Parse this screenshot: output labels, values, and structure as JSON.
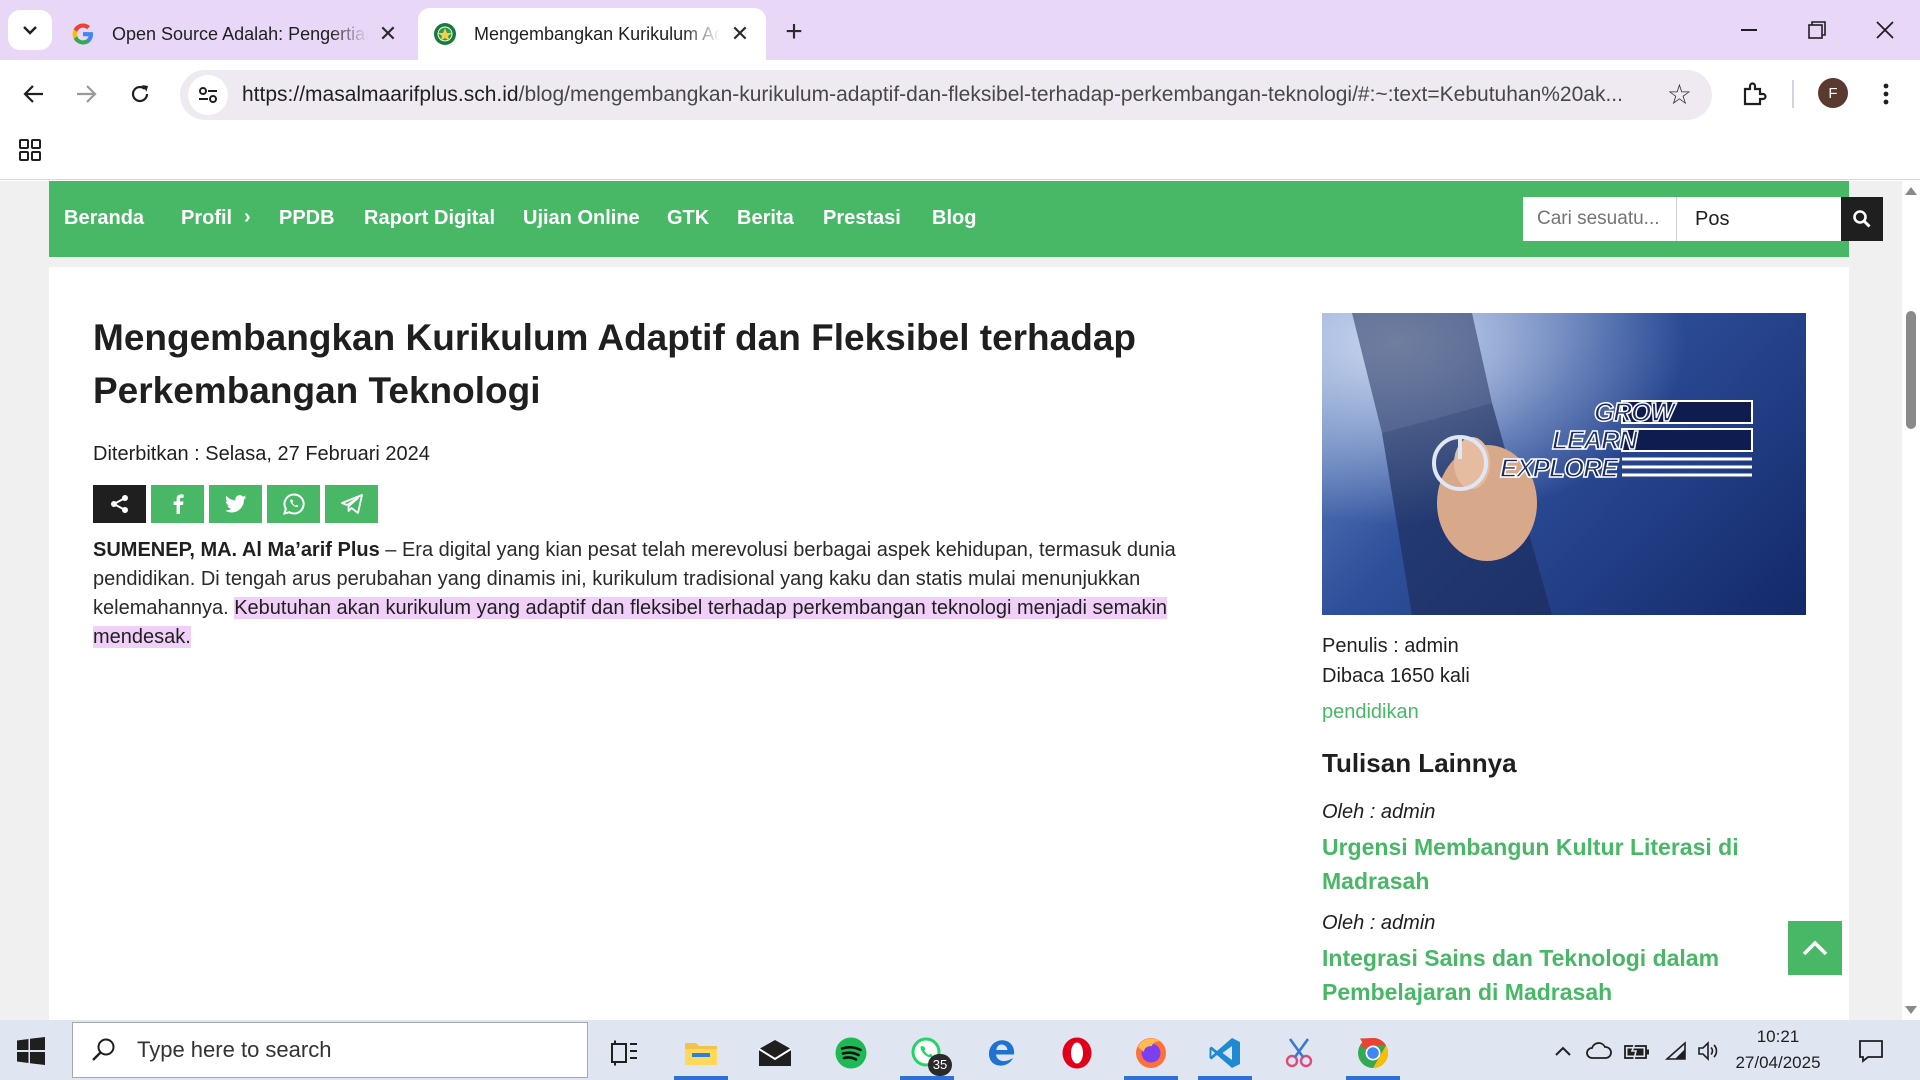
{
  "browser": {
    "tabs": [
      {
        "title": "Open Source Adalah: Pengertian",
        "favicon": "google-g-icon",
        "active": false
      },
      {
        "title": "Mengembangkan Kurikulum Adaptif",
        "favicon": "school-logo-icon",
        "active": true
      }
    ],
    "url_host": "https://masalmaarifplus.sch.id",
    "url_path": "/blog/mengembangkan-kurikulum-adaptif-dan-fleksibel-terhadap-perkembangan-teknologi/#:~:text=Kebutuhan%20ak...",
    "profile_initial": "F"
  },
  "site": {
    "accent_color": "#48b866",
    "nav": [
      {
        "label": "Beranda"
      },
      {
        "label": "Profil",
        "has_submenu": true
      },
      {
        "label": "PPDB"
      },
      {
        "label": "Raport Digital"
      },
      {
        "label": "Ujian Online"
      },
      {
        "label": "GTK"
      },
      {
        "label": "Berita"
      },
      {
        "label": "Prestasi"
      },
      {
        "label": "Blog"
      }
    ],
    "search": {
      "placeholder": "Cari sesuatu...",
      "scope_value": "Pos"
    }
  },
  "article": {
    "title": "Mengembangkan Kurikulum Adaptif dan Fleksibel terhadap Perkembangan Teknologi",
    "published": "Diterbitkan : Selasa, 27 Februari 2024",
    "share_buttons": [
      "share-icon",
      "facebook-icon",
      "twitter-icon",
      "whatsapp-icon",
      "telegram-icon"
    ],
    "lead_bold": "SUMENEP, MA. Al Ma’arif Plus",
    "lead_text": " – Era digital yang kian pesat telah merevolusi berbagai aspek kehidupan, termasuk dunia pendidikan. Di tengah arus perubahan yang dinamis ini, kurikulum tradisional yang kaku dan statis mulai menunjukkan kelemahannya. ",
    "highlighted_text": "Kebutuhan akan kurikulum yang adaptif dan fleksibel terhadap perkembangan teknologi menjadi semakin mendesak."
  },
  "sidebar": {
    "image_words": [
      "GROW",
      "LEARN",
      "EXPLORE"
    ],
    "author": "Penulis : admin",
    "views": "Dibaca 1650 kali",
    "category": "pendidikan",
    "other_posts_heading": "Tulisan Lainnya",
    "other_posts": [
      {
        "author": "Oleh : admin",
        "title": "Urgensi Membangun Kultur Literasi di Madrasah"
      },
      {
        "author": "Oleh : admin",
        "title": "Integrasi Sains dan Teknologi dalam Pembelajaran di Madrasah"
      }
    ]
  },
  "taskbar": {
    "search_placeholder": "Type here to search",
    "whatsapp_badge": "35",
    "time": "10:21",
    "date": "27/04/2025"
  }
}
